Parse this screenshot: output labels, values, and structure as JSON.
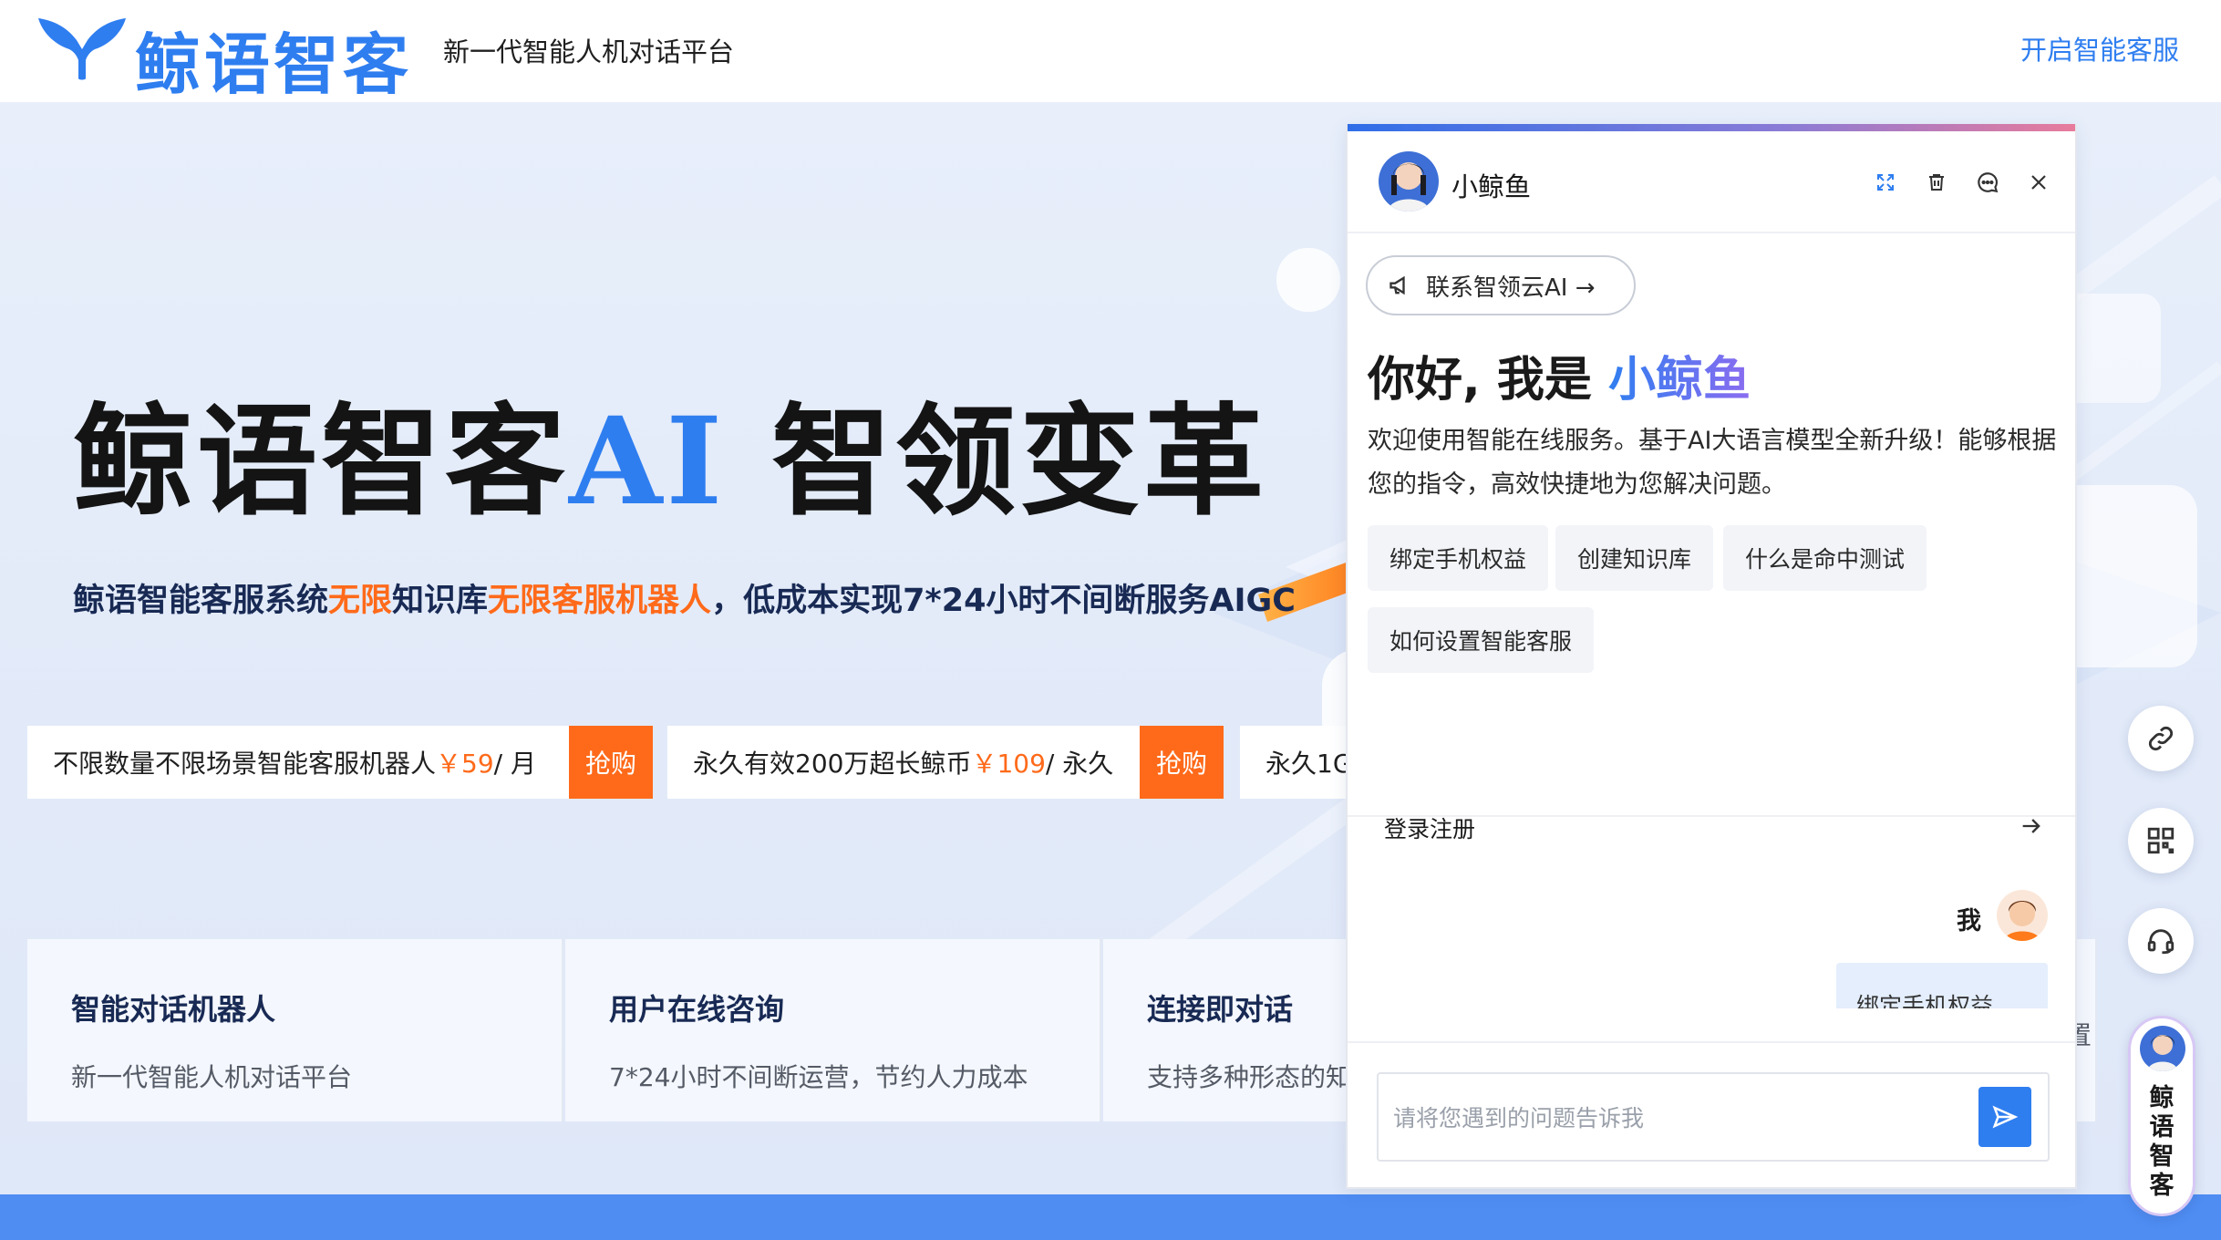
{
  "nav": {
    "logo_text": "鲸语智客",
    "tagline": "新一代智能人机对话平台",
    "cta": "开启智能客服"
  },
  "hero": {
    "title_prefix": "鲸语智客",
    "title_ai": "AI",
    "title_suffix": " 智领变革",
    "sub": {
      "p1": "鲸语智能客服系统",
      "h1": "无限",
      "p2": "知识库",
      "h2": "无限客服机器人",
      "p3": "，低成本实现7*24小时不间断服务AIGC"
    }
  },
  "offers": [
    {
      "text": "不限数量不限场景智能客服机器人",
      "price": "￥59",
      "unit": "/ 月",
      "button": "抢购"
    },
    {
      "text": "永久有效200万超长鲸币",
      "price": "￥109",
      "unit": "/ 永久",
      "button": "抢购"
    },
    {
      "text": "永久1G"
    }
  ],
  "features": [
    {
      "title": "智能对话机器人",
      "desc": "新一代智能人机对话平台"
    },
    {
      "title": "用户在线咨询",
      "desc": "7*24小时不间断运营，节约人力成本"
    },
    {
      "title": "连接即对话",
      "desc": "支持多种形态的知"
    },
    {
      "title": "",
      "desc": "置"
    }
  ],
  "chat": {
    "agent_name": "小鲸鱼",
    "contact_label": "联系智领云AI →",
    "greeting_prefix": "你好, 我是 ",
    "greeting_name": "小鲸鱼",
    "welcome": "欢迎使用智能在线服务。基于AI大语言模型全新升级！能够根据您的指令，高效快捷地为您解决问题。",
    "chips": [
      "绑定手机权益",
      "创建知识库",
      "什么是命中测试",
      "如何设置智能客服"
    ],
    "login_label": "登录注册",
    "me_label": "我",
    "me_message": "绑定手机权益",
    "input_placeholder": "请将您遇到的问题告诉我"
  },
  "float_bar": {
    "icons": [
      "link-icon",
      "qrcode-icon",
      "headset-icon"
    ],
    "brand_chars": [
      "鲸",
      "语",
      "智",
      "客"
    ]
  },
  "colors": {
    "brand_blue": "#2f7ef0",
    "accent_orange": "#ff6a1a",
    "navy_text": "#182a54"
  }
}
